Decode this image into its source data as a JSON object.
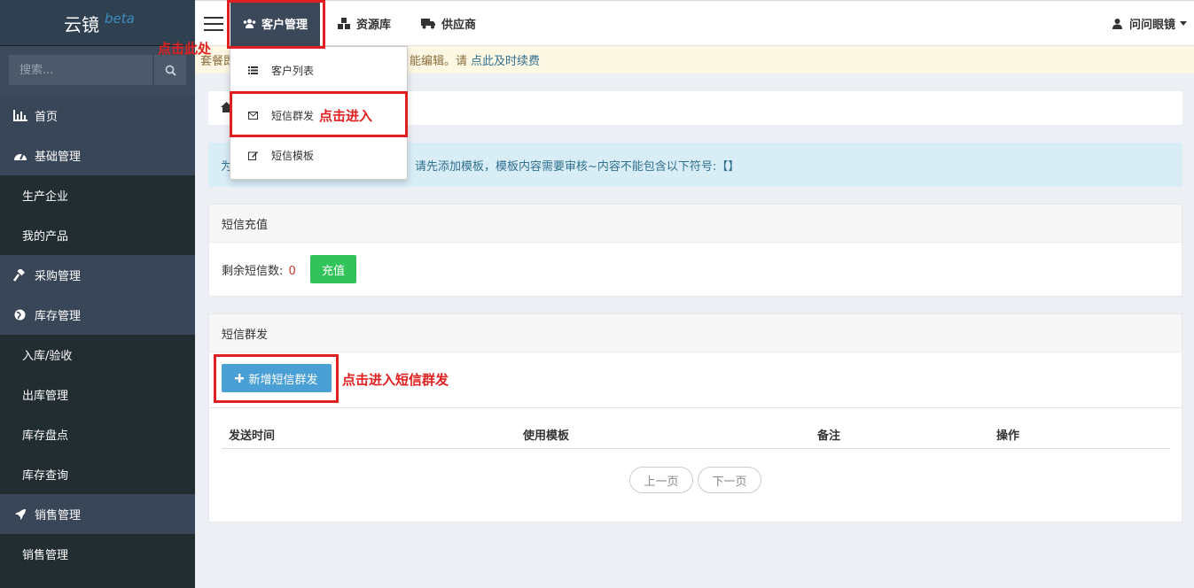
{
  "sidebar": {
    "logo": "云镜",
    "beta": "beta",
    "search_placeholder": "搜索...",
    "items": [
      {
        "label": "首页",
        "icon": "bar-chart-icon"
      },
      {
        "label": "基础管理",
        "icon": "dashboard-icon"
      },
      {
        "label": "生产企业"
      },
      {
        "label": "我的产品"
      },
      {
        "label": "采购管理",
        "icon": "gavel-icon"
      },
      {
        "label": "库存管理",
        "icon": "globe-icon"
      },
      {
        "label": "入库/验收"
      },
      {
        "label": "出库管理"
      },
      {
        "label": "库存盘点"
      },
      {
        "label": "库存查询"
      },
      {
        "label": "销售管理",
        "icon": "rocket-icon"
      },
      {
        "label": "销售管理"
      }
    ]
  },
  "header": {
    "nav": [
      {
        "label": "客户管理",
        "icon": "users-icon"
      },
      {
        "label": "资源库",
        "icon": "cubes-icon"
      },
      {
        "label": "供应商",
        "icon": "truck-icon"
      }
    ],
    "user": "问问眼镜"
  },
  "notice": {
    "prefix": "套餐即",
    "middle": "能编辑。请",
    "link": "点此及时续费"
  },
  "dropdown": {
    "items": [
      {
        "label": "客户列表",
        "icon": "list-icon"
      },
      {
        "label": "短信群发",
        "icon": "envelope-icon"
      },
      {
        "label": "短信模板",
        "icon": "edit-icon"
      }
    ]
  },
  "alert": {
    "prefix": "为",
    "text": "请先添加模板，模板内容需要审核~内容不能包含以下符号:【】"
  },
  "recharge_panel": {
    "title": "短信充值",
    "remaining_label": "剩余短信数:",
    "remaining_value": "0",
    "button": "充值"
  },
  "send_panel": {
    "title": "短信群发",
    "add_button": "新增短信群发",
    "columns": [
      "发送时间",
      "使用模板",
      "备注",
      "操作"
    ],
    "prev": "上一页",
    "next": "下一页"
  },
  "annotations": {
    "click_here": "点击此处",
    "click_enter": "点击进入",
    "click_enter_sms": "点击进入短信群发"
  },
  "colors": {
    "sidebar_bg": "#222d32",
    "sidebar_top_item": "#394657",
    "active_nav": "#3b4859",
    "green_button": "#33c35b",
    "blue_button": "#4a9fd5",
    "annotation_red": "#e02020"
  }
}
